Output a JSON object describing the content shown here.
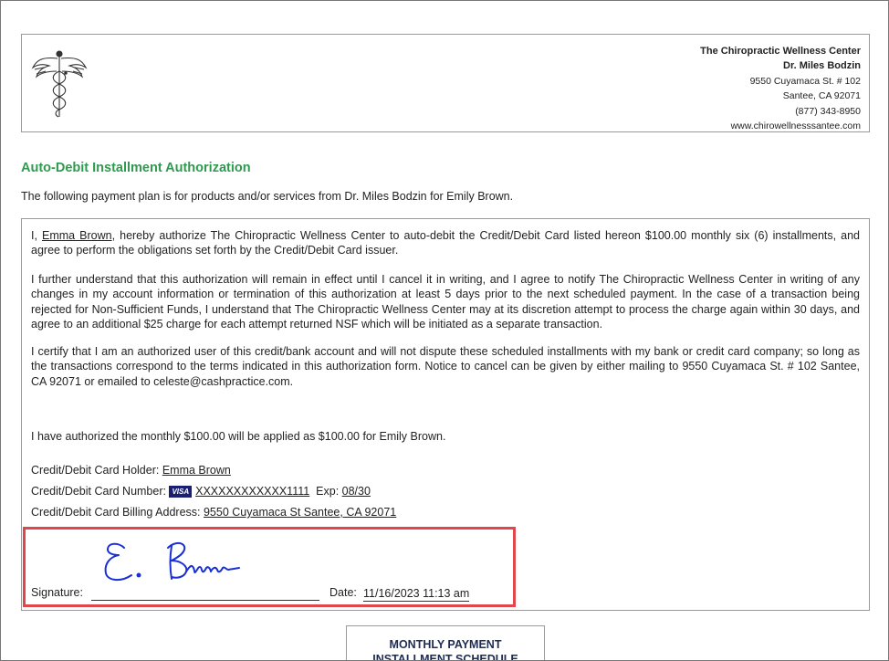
{
  "clinic": {
    "name": "The Chiropractic Wellness Center",
    "doctor": "Dr. Miles Bodzin",
    "street": "9550 Cuyamaca St. # 102",
    "city": "Santee, CA 92071",
    "phone": "(877) 343-8950",
    "website": "www.chirowellnesssantee.com"
  },
  "title": "Auto-Debit Installment Authorization",
  "intro": "The following payment plan is for products and/or services from Dr. Miles Bodzin for Emily Brown.",
  "authorization": {
    "p1_prefix": "I, ",
    "p1_name": "Emma Brown",
    "p1_rest": ", hereby authorize The Chiropractic Wellness Center to auto-debit the Credit/Debit Card listed hereon $100.00 monthly six (6) installments, and agree to perform the obligations set forth by the Credit/Debit Card issuer.",
    "p2": "I further understand that this authorization will remain in effect until I cancel it in writing, and I agree to notify The Chiropractic Wellness Center in writing of any changes in my account information or termination of this authorization at least 5 days prior to the next scheduled payment. In the case of a transaction being rejected for Non-Sufficient Funds, I understand that The Chiropractic Wellness Center may at its discretion attempt to process the charge again within 30 days, and agree to an additional $25 charge for each attempt returned NSF which will be initiated as a separate transaction.",
    "p3": "I certify that I am an authorized user of this credit/bank account and will not dispute these scheduled installments with my bank or credit card company; so long as the transactions correspond to the terms indicated in this authorization form.  Notice to cancel can be given by either mailing to 9550 Cuyamaca St. # 102 Santee, CA 92071 or emailed to celeste@cashpractice.com.",
    "p4": "I have authorized the monthly $100.00 will be applied as $100.00 for Emily Brown."
  },
  "card": {
    "holder_label": "Credit/Debit Card Holder:",
    "holder_value": "Emma Brown",
    "number_label": "Credit/Debit Card Number:",
    "brand": "VISA",
    "number_value": "XXXXXXXXXXXX1111",
    "exp_label": "Exp:",
    "exp_value": "08/30",
    "address_label": "Credit/Debit Card Billing Address:",
    "address_value": "9550 Cuyamaca St Santee, CA 92071"
  },
  "signature": {
    "label": "Signature:",
    "date_label": "Date:",
    "date_value": "11/16/2023 11:13 am",
    "ink_color": "#1a2fd6",
    "highlight_color": "#e0474c"
  },
  "schedule": {
    "title_line1": "MONTHLY PAYMENT",
    "title_line2": "INSTALLMENT SCHEDULE"
  },
  "colors": {
    "title": "#2f9a4f",
    "schedule_title": "#1e2b55"
  }
}
